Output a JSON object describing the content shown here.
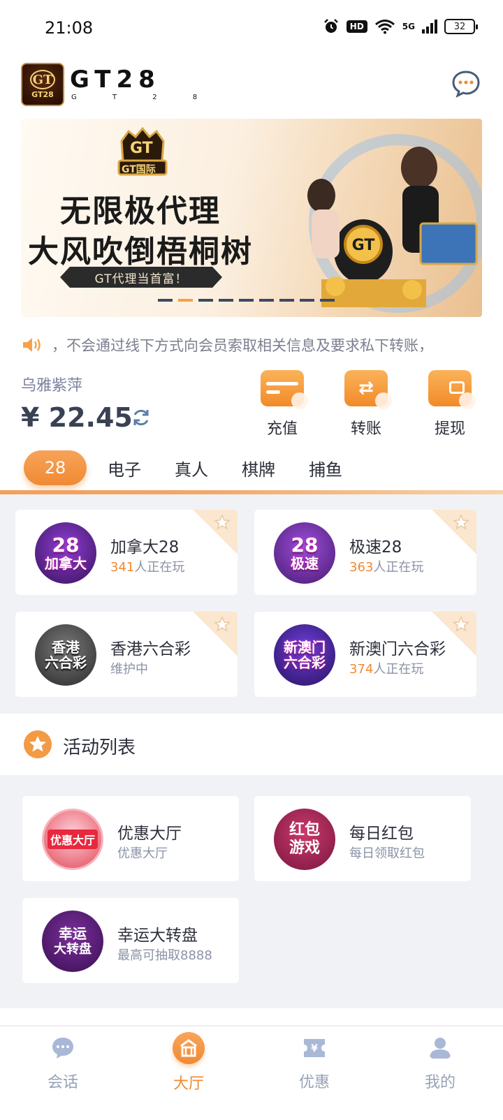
{
  "status_bar": {
    "time": "21:08",
    "network": "5G",
    "hd": "HD",
    "battery": "32"
  },
  "header": {
    "logo_badge_top": "GT",
    "logo_badge_bottom": "GT28",
    "brand": "GT28",
    "brand_sub": "G T 2 8"
  },
  "banner": {
    "crest_text": "GT",
    "crest_sub": "GT国际",
    "line1": "无限极代理",
    "line2": "大风吹倒梧桐树",
    "pill": "GT代理当首富！",
    "active_dot": 1,
    "dot_count": 9
  },
  "marquee": {
    "text": "，不会通过线下方式向会员索取相关信息及要求私下转账，"
  },
  "account": {
    "name": "乌雅紫萍",
    "balance": "¥ 22.45"
  },
  "actions": [
    {
      "label": "充值",
      "icon": "card-icon"
    },
    {
      "label": "转账",
      "icon": "transfer-icon"
    },
    {
      "label": "提现",
      "icon": "wallet-icon"
    }
  ],
  "categories": [
    "28",
    "电子",
    "真人",
    "棋牌",
    "捕鱼"
  ],
  "games": [
    {
      "name": "加拿大28",
      "count": "341",
      "suffix": "人正在玩",
      "avatar_big": "28",
      "avatar_small": "加拿大"
    },
    {
      "name": "极速28",
      "count": "363",
      "suffix": "人正在玩",
      "avatar_big": "28",
      "avatar_small": "极速"
    },
    {
      "name": "香港六合彩",
      "status": "维护中",
      "avatar_big": "香港",
      "avatar_small": "六合彩"
    },
    {
      "name": "新澳门六合彩",
      "count": "374",
      "suffix": "人正在玩",
      "avatar_big": "新澳门",
      "avatar_small": "六合彩"
    }
  ],
  "activity": {
    "title": "活动列表",
    "items": [
      {
        "name": "优惠大厅",
        "sub": "优惠大厅",
        "avatar": "优惠大厅"
      },
      {
        "name": "每日红包",
        "sub": "每日领取红包",
        "avatar_top": "红包",
        "avatar_bottom": "游戏"
      },
      {
        "name": "幸运大转盘",
        "sub": "最高可抽取8888",
        "avatar_top": "幸运",
        "avatar_bottom": "大转盘"
      }
    ]
  },
  "bottom_nav": [
    {
      "label": "会话",
      "icon": "chat-icon"
    },
    {
      "label": "大厅",
      "icon": "hall-icon"
    },
    {
      "label": "优惠",
      "icon": "coupon-icon"
    },
    {
      "label": "我的",
      "icon": "user-icon"
    }
  ],
  "colors": {
    "accent": "#f08a33",
    "text": "#2c2f3a",
    "muted": "#8a92a6",
    "bg_gray": "#f1f2f5"
  }
}
